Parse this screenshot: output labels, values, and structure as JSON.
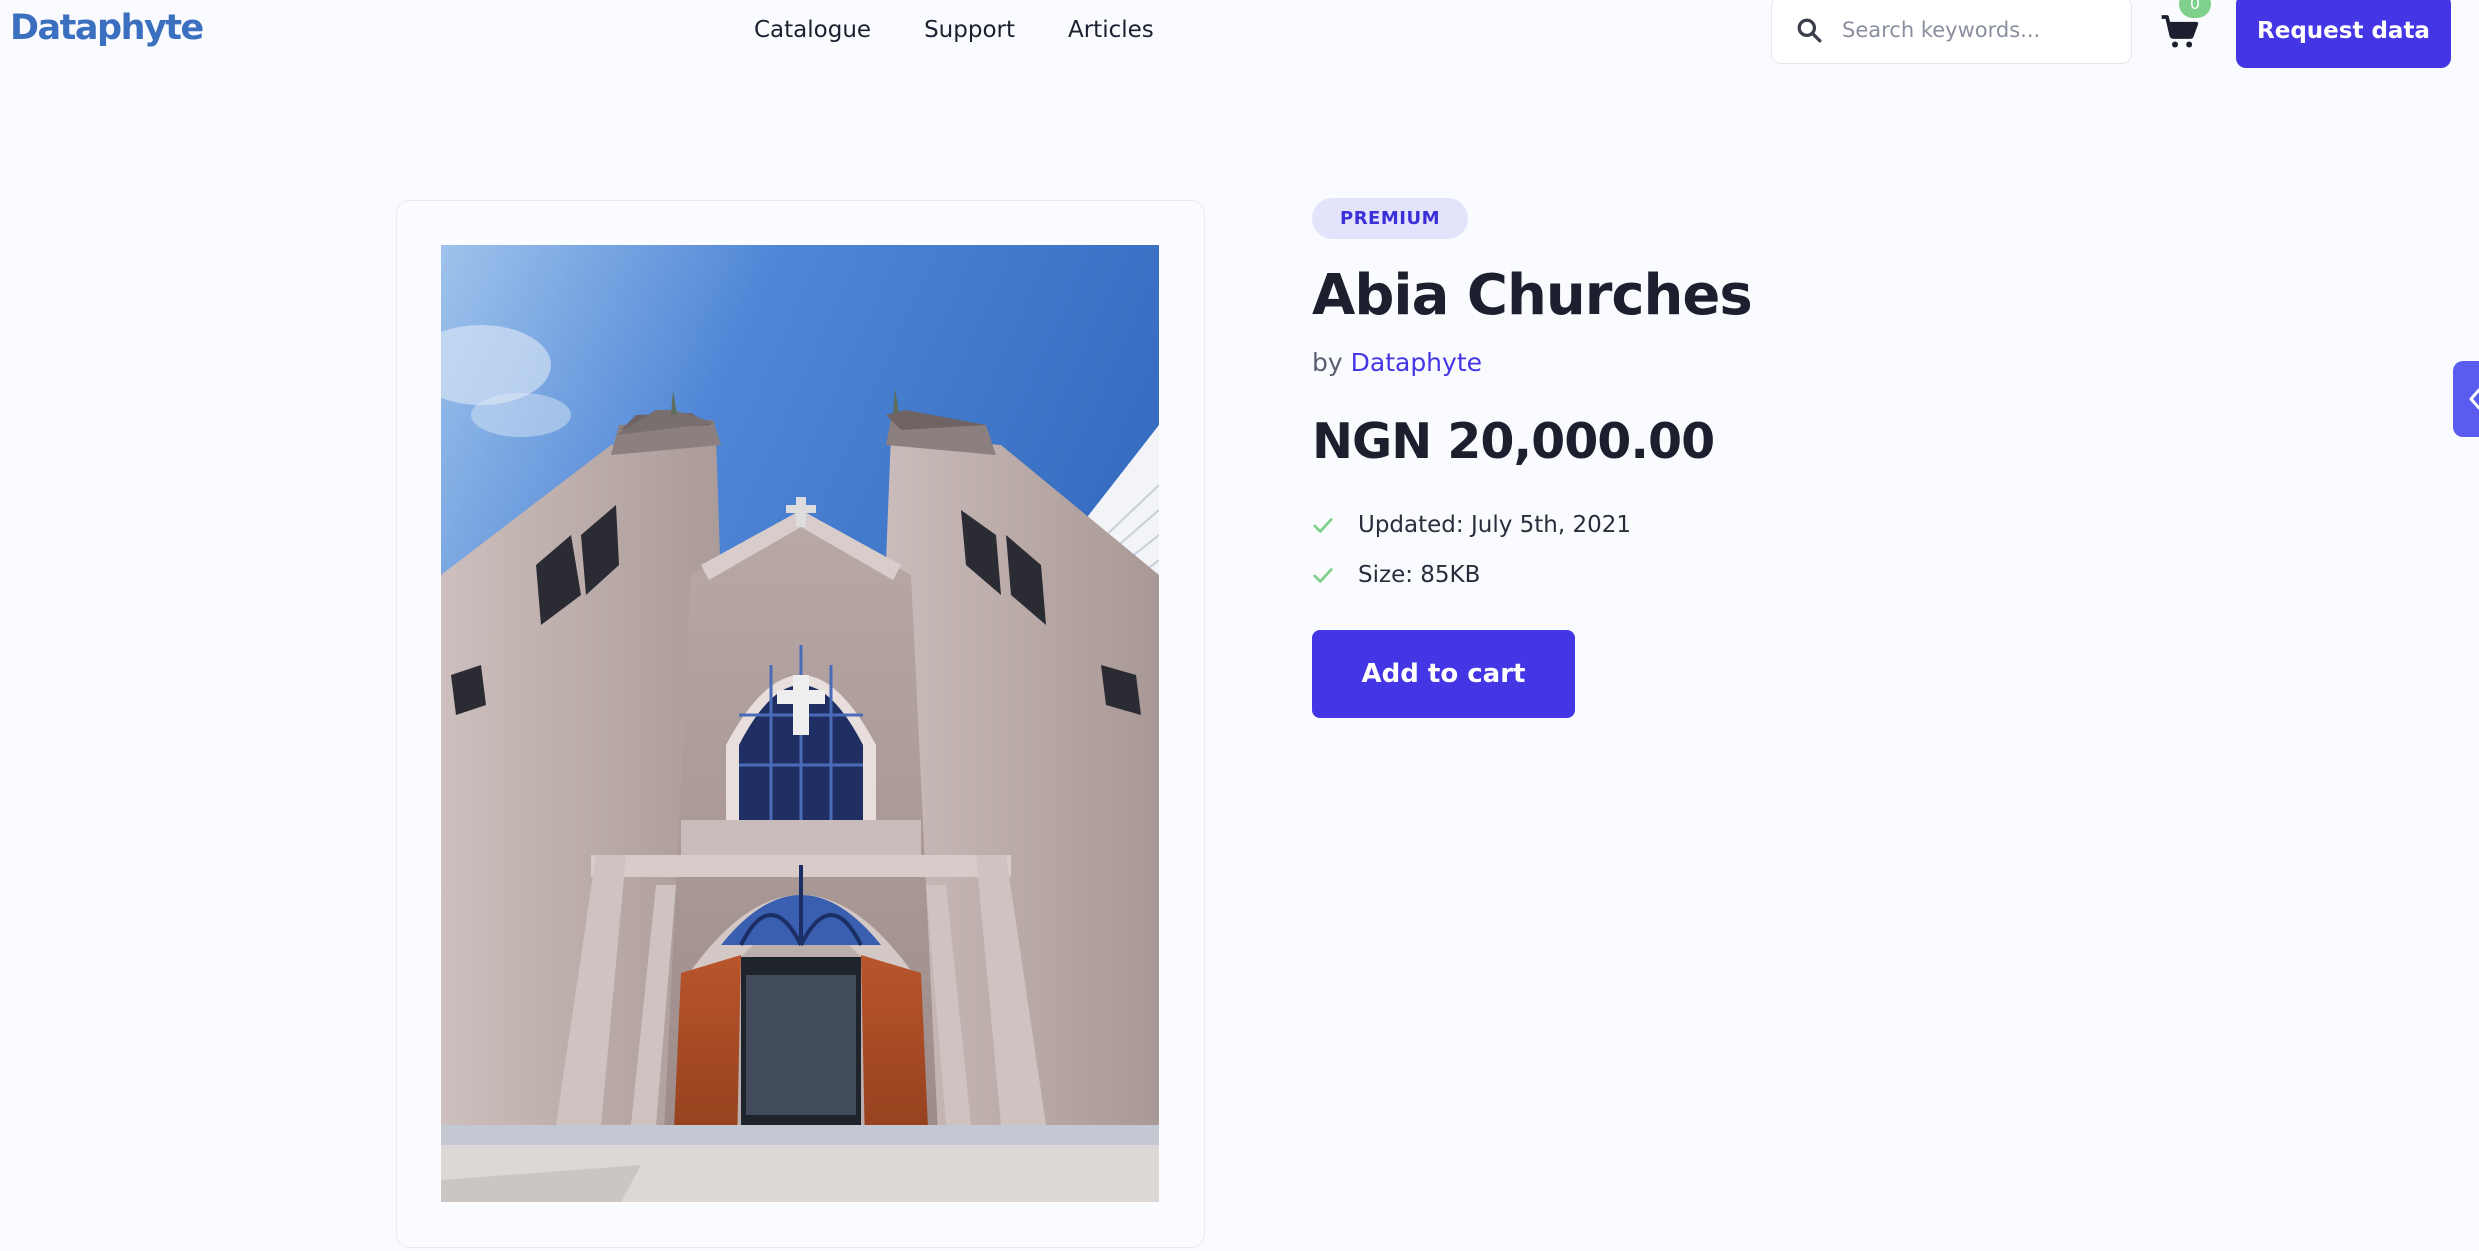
{
  "header": {
    "logo": "Dataphyte",
    "nav": [
      "Catalogue",
      "Support",
      "Articles"
    ],
    "search_placeholder": "Search keywords...",
    "cart_count": "0",
    "request_label": "Request data"
  },
  "product": {
    "badge": "PREMIUM",
    "title": "Abia Churches",
    "by_prefix": "by",
    "author": "Dataphyte",
    "price": "NGN 20,000.00",
    "updated": "Updated: July 5th, 2021",
    "size": "Size: 85KB",
    "add_to_cart": "Add to cart"
  },
  "colors": {
    "accent": "#4536e5",
    "badge_bg": "#e3e3fb",
    "check": "#7ed08a",
    "logo": "#3b6fbf"
  },
  "icons": [
    "search-icon",
    "cart-icon",
    "check-icon",
    "chevron-left-icon"
  ]
}
